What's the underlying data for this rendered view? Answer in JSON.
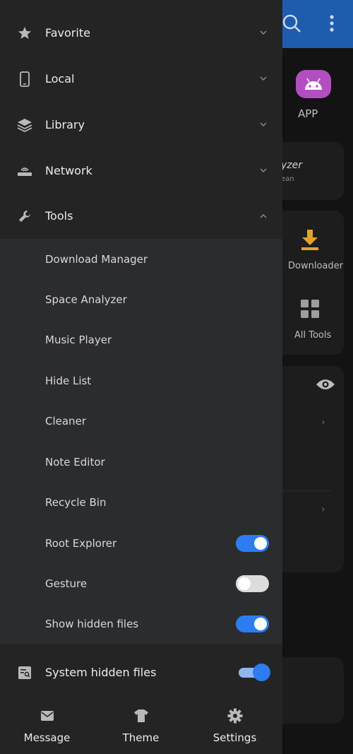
{
  "background_app": {
    "app_label": "APP",
    "card_title": "yzer",
    "card_subtitle": "ean",
    "downloader_label": "Downloader",
    "all_tools_label": "All Tools"
  },
  "drawer": {
    "menu": [
      {
        "label": "Favorite",
        "icon": "star-icon",
        "expanded": false
      },
      {
        "label": "Local",
        "icon": "phone-icon",
        "expanded": false
      },
      {
        "label": "Library",
        "icon": "layers-icon",
        "expanded": false
      },
      {
        "label": "Network",
        "icon": "router-icon",
        "expanded": false
      },
      {
        "label": "Tools",
        "icon": "wrench-icon",
        "expanded": true
      }
    ],
    "tools": [
      {
        "label": "Download Manager"
      },
      {
        "label": "Space Analyzer"
      },
      {
        "label": "Music Player"
      },
      {
        "label": "Hide List"
      },
      {
        "label": "Cleaner"
      },
      {
        "label": "Note Editor"
      },
      {
        "label": "Recycle Bin"
      },
      {
        "label": "Root Explorer",
        "toggle": true
      },
      {
        "label": "Gesture",
        "toggle": false
      },
      {
        "label": "Show hidden files",
        "toggle": true
      }
    ],
    "system_hidden": {
      "label": "System hidden files",
      "toggle": true,
      "icon": "file-search-icon"
    },
    "bottom_nav": [
      {
        "label": "Message",
        "icon": "mail-icon"
      },
      {
        "label": "Theme",
        "icon": "shirt-icon"
      },
      {
        "label": "Settings",
        "icon": "gear-icon"
      }
    ]
  },
  "colors": {
    "accent": "#2d7cf0",
    "topbar": "#1e5cae",
    "drawer_bg": "#242424",
    "tools_bg": "#2b2c2e"
  }
}
